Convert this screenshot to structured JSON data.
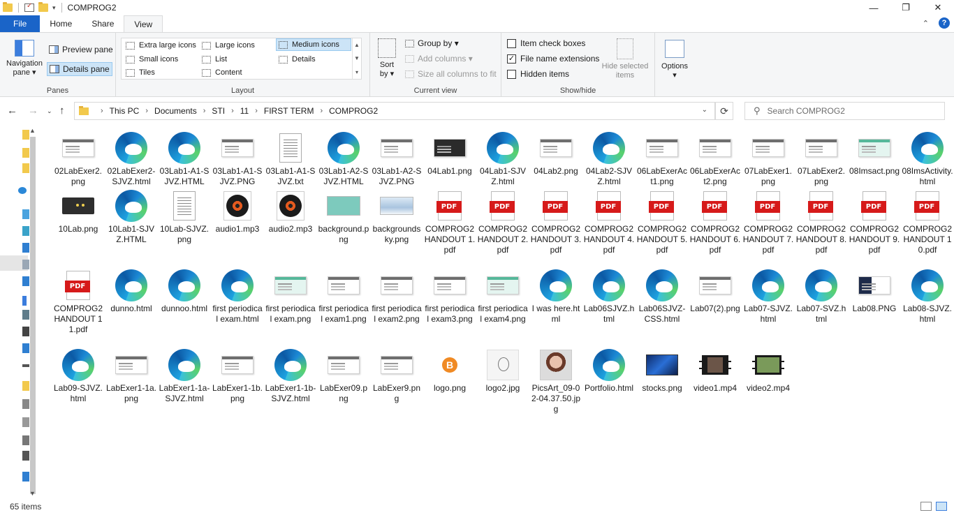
{
  "window": {
    "title": "COMPROG2",
    "minimize": "—",
    "maximize": "❐",
    "close": "✕"
  },
  "tabs": [
    {
      "label": "File"
    },
    {
      "label": "Home"
    },
    {
      "label": "Share"
    },
    {
      "label": "View"
    }
  ],
  "ribbon": {
    "panes": {
      "navigation_pane": "Navigation",
      "navigation_pane_line2": "pane ▾",
      "preview_pane": "Preview pane",
      "details_pane": "Details pane",
      "group_label": "Panes"
    },
    "layout": {
      "items": [
        "Extra large icons",
        "Large icons",
        "Medium icons",
        "Small icons",
        "List",
        "Details",
        "Tiles",
        "Content"
      ],
      "selected": "Medium icons",
      "group_label": "Layout"
    },
    "current_view": {
      "sort_by": "Sort",
      "sort_by_line2": "by ▾",
      "group_by": "Group by ▾",
      "add_columns": "Add columns ▾",
      "size_columns": "Size all columns to fit",
      "group_label": "Current view"
    },
    "show_hide": {
      "item_check_boxes": "Item check boxes",
      "item_check_boxes_checked": false,
      "file_name_extensions": "File name extensions",
      "file_name_extensions_checked": true,
      "hidden_items": "Hidden items",
      "hidden_items_checked": false,
      "hide_selected": "Hide selected",
      "hide_selected_line2": "items",
      "group_label": "Show/hide"
    },
    "options": {
      "label": "Options",
      "caret": "▾"
    }
  },
  "address": {
    "crumbs": [
      "This PC",
      "Documents",
      "STI",
      "11",
      "FIRST TERM",
      "COMPROG2"
    ],
    "search_placeholder": "Search COMPROG2"
  },
  "files": [
    {
      "name": "02LabExer2.png",
      "icon": "screenshot"
    },
    {
      "name": "02LabExer2-SJVZ.html",
      "icon": "edge"
    },
    {
      "name": "03Lab1-A1-SJVZ.HTML",
      "icon": "edge"
    },
    {
      "name": "03Lab1-A1-SJVZ.PNG",
      "icon": "screenshot"
    },
    {
      "name": "03Lab1-A1-SJVZ.txt",
      "icon": "text"
    },
    {
      "name": "03Lab1-A2-SJVZ.HTML",
      "icon": "edge"
    },
    {
      "name": "03Lab1-A2-SJVZ.PNG",
      "icon": "screenshot"
    },
    {
      "name": "04Lab1.png",
      "icon": "screenshot-dark"
    },
    {
      "name": "04Lab1-SJVZ.html",
      "icon": "edge"
    },
    {
      "name": "04Lab2.png",
      "icon": "screenshot"
    },
    {
      "name": "04Lab2-SJVZ.html",
      "icon": "edge"
    },
    {
      "name": "06LabExerAct1.png",
      "icon": "screenshot"
    },
    {
      "name": "06LabExerAct2.png",
      "icon": "screenshot"
    },
    {
      "name": "07LabExer1.png",
      "icon": "screenshot"
    },
    {
      "name": "07LabExer2.png",
      "icon": "screenshot"
    },
    {
      "name": "08Imsact.png",
      "icon": "screenshot-teal"
    },
    {
      "name": "08ImsActivity.html",
      "icon": "edge"
    },
    {
      "name": "10Lab.png",
      "icon": "dark-banner"
    },
    {
      "name": "10Lab1-SJVZ.HTML",
      "icon": "edge"
    },
    {
      "name": "10Lab-SJVZ.png",
      "icon": "text"
    },
    {
      "name": "audio1.mp3",
      "icon": "audio"
    },
    {
      "name": "audio2.mp3",
      "icon": "audio"
    },
    {
      "name": "background.png",
      "icon": "teal-image"
    },
    {
      "name": "backgroundsky.png",
      "icon": "sky-image"
    },
    {
      "name": "COMPROG2 HANDOUT 1.pdf",
      "icon": "pdf"
    },
    {
      "name": "COMPROG2 HANDOUT 2.pdf",
      "icon": "pdf"
    },
    {
      "name": "COMPROG2 HANDOUT 3.pdf",
      "icon": "pdf"
    },
    {
      "name": "COMPROG2 HANDOUT 4.pdf",
      "icon": "pdf"
    },
    {
      "name": "COMPROG2 HANDOUT 5.pdf",
      "icon": "pdf"
    },
    {
      "name": "COMPROG2 HANDOUT 6.pdf",
      "icon": "pdf"
    },
    {
      "name": "COMPROG2 HANDOUT 7.pdf",
      "icon": "pdf"
    },
    {
      "name": "COMPROG2 HANDOUT 8.pdf",
      "icon": "pdf"
    },
    {
      "name": "COMPROG2 HANDOUT 9.pdf",
      "icon": "pdf"
    },
    {
      "name": "COMPROG2 HANDOUT 10.pdf",
      "icon": "pdf"
    },
    {
      "name": "COMPROG2 HANDOUT 11.pdf",
      "icon": "pdf"
    },
    {
      "name": "dunno.html",
      "icon": "edge"
    },
    {
      "name": "dunnoo.html",
      "icon": "edge"
    },
    {
      "name": "first periodical exam.html",
      "icon": "edge"
    },
    {
      "name": "first periodical exam.png",
      "icon": "screenshot-teal"
    },
    {
      "name": "first periodical exam1.png",
      "icon": "screenshot"
    },
    {
      "name": "first periodical exam2.png",
      "icon": "screenshot"
    },
    {
      "name": "first periodical exam3.png",
      "icon": "screenshot"
    },
    {
      "name": "first periodical exam4.png",
      "icon": "screenshot-teal"
    },
    {
      "name": "I was here.html",
      "icon": "edge"
    },
    {
      "name": "Lab06SJVZ.html",
      "icon": "edge"
    },
    {
      "name": "Lab06SJVZ-CSS.html",
      "icon": "edge"
    },
    {
      "name": "Lab07(2).png",
      "icon": "screenshot"
    },
    {
      "name": "Lab07-SJVZ.html",
      "icon": "edge"
    },
    {
      "name": "Lab07-SVZ.html",
      "icon": "edge"
    },
    {
      "name": "Lab08.PNG",
      "icon": "screenshot-nav"
    },
    {
      "name": "Lab08-SJVZ.html",
      "icon": "edge"
    },
    {
      "name": "Lab09-SJVZ.html",
      "icon": "edge"
    },
    {
      "name": "LabExer1-1a.png",
      "icon": "screenshot"
    },
    {
      "name": "LabExer1-1a-SJVZ.html",
      "icon": "edge"
    },
    {
      "name": "LabExer1-1b.png",
      "icon": "screenshot"
    },
    {
      "name": "LabExer1-1b-SJVZ.html",
      "icon": "edge"
    },
    {
      "name": "LabExer09.png",
      "icon": "screenshot"
    },
    {
      "name": "LabExer9.png",
      "icon": "screenshot"
    },
    {
      "name": "logo.png",
      "icon": "logo"
    },
    {
      "name": "logo2.jpg",
      "icon": "sketch"
    },
    {
      "name": "PicsArt_09-02-04.37.50.jpg",
      "icon": "portrait"
    },
    {
      "name": "Portfolio.html",
      "icon": "edge"
    },
    {
      "name": "stocks.png",
      "icon": "stocks"
    },
    {
      "name": "video1.mp4",
      "icon": "video"
    },
    {
      "name": "video2.mp4",
      "icon": "video2"
    }
  ],
  "status": {
    "count": "65 items"
  }
}
